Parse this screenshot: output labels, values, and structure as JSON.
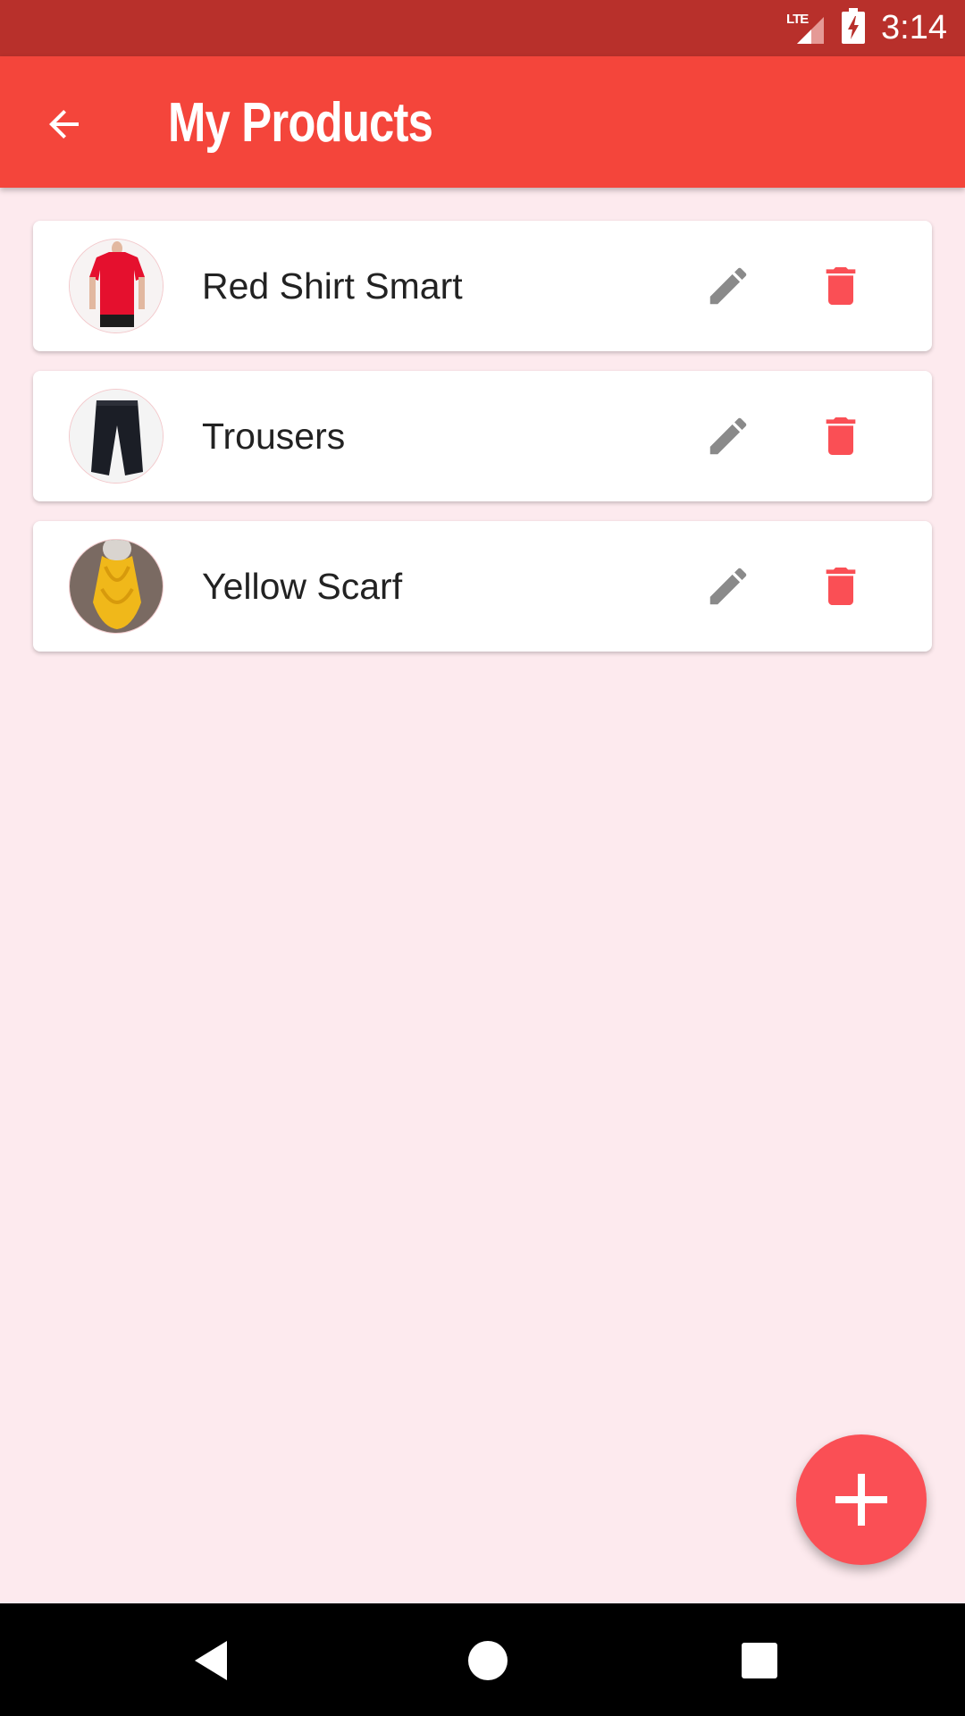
{
  "status_bar": {
    "network": "LTE",
    "time": "3:14",
    "icons": [
      "lte-signal-icon",
      "battery-charging-icon"
    ]
  },
  "app_bar": {
    "title": "My Products",
    "back_icon": "arrow-back-icon"
  },
  "products": [
    {
      "title": "Red Shirt Smart",
      "thumbnail": "red-shirt-image"
    },
    {
      "title": "Trousers",
      "thumbnail": "trousers-image"
    },
    {
      "title": "Yellow Scarf",
      "thumbnail": "yellow-scarf-image"
    }
  ],
  "actions": {
    "edit_icon": "pencil-icon",
    "delete_icon": "trash-icon"
  },
  "fab": {
    "icon": "plus-icon"
  },
  "colors": {
    "status_bar": "#b8302b",
    "app_bar": "#f4453b",
    "background": "#fdeaee",
    "accent": "#fa4f55",
    "edit_icon": "#8a8a8a"
  },
  "nav_bar": {
    "icons": [
      "nav-back-icon",
      "nav-home-icon",
      "nav-recents-icon"
    ]
  }
}
